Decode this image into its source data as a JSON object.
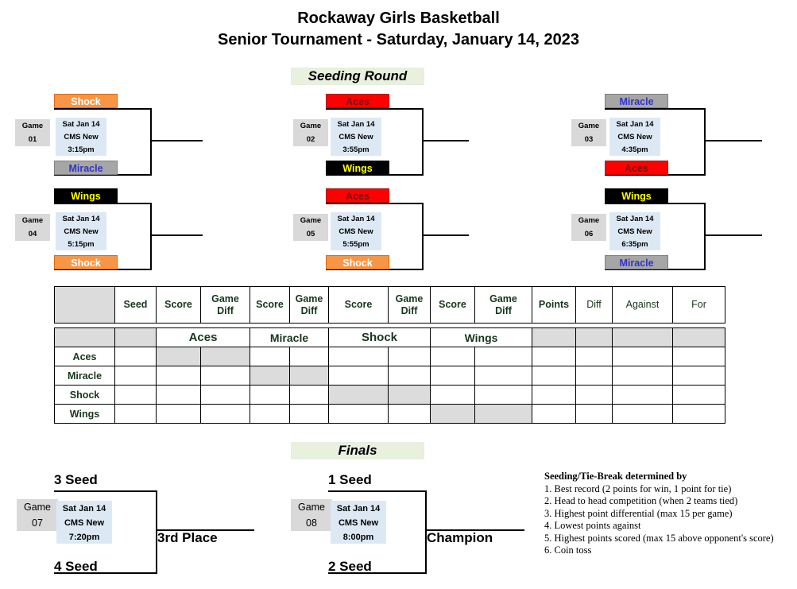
{
  "title": {
    "line1": "Rockaway Girls Basketball",
    "line2": "Senior Tournament - Saturday, January 14, 2023"
  },
  "sections": {
    "seeding_round": "Seeding Round",
    "finals": "Finals"
  },
  "seeding_games": [
    {
      "label_top": "Game",
      "label_num": "01",
      "date": "Sat Jan 14",
      "venue": "CMS New",
      "time": "3:15pm",
      "top_team": "Shock",
      "bottom_team": "Miracle"
    },
    {
      "label_top": "Game",
      "label_num": "02",
      "date": "Sat Jan 14",
      "venue": "CMS New",
      "time": "3:55pm",
      "top_team": "Aces",
      "bottom_team": "Wings"
    },
    {
      "label_top": "Game",
      "label_num": "03",
      "date": "Sat Jan 14",
      "venue": "CMS New",
      "time": "4:35pm",
      "top_team": "Miracle",
      "bottom_team": "Aces"
    },
    {
      "label_top": "Game",
      "label_num": "04",
      "date": "Sat Jan 14",
      "venue": "CMS New",
      "time": "5:15pm",
      "top_team": "Wings",
      "bottom_team": "Shock"
    },
    {
      "label_top": "Game",
      "label_num": "05",
      "date": "Sat Jan 14",
      "venue": "CMS New",
      "time": "5:55pm",
      "top_team": "Aces",
      "bottom_team": "Shock"
    },
    {
      "label_top": "Game",
      "label_num": "06",
      "date": "Sat Jan 14",
      "venue": "CMS New",
      "time": "6:35pm",
      "top_team": "Wings",
      "bottom_team": "Miracle"
    }
  ],
  "standings": {
    "header_row": [
      "",
      "Seed",
      "Score",
      "Game Diff",
      "Score",
      "Game Diff",
      "Score",
      "Game Diff",
      "Score",
      "Game Diff",
      "Points",
      "Diff",
      "Against",
      "For"
    ],
    "opponent_row": [
      "",
      "",
      "Aces",
      "Miracle",
      "Shock",
      "Wings",
      "",
      "",
      "",
      ""
    ],
    "rows": [
      {
        "team": "Aces"
      },
      {
        "team": "Miracle"
      },
      {
        "team": "Shock"
      },
      {
        "team": "Wings"
      }
    ]
  },
  "finals_games": [
    {
      "label_top": "Game",
      "label_num": "07",
      "date": "Sat Jan 14",
      "venue": "CMS New",
      "time": "7:20pm",
      "top_seed": "3 Seed",
      "bottom_seed": "4 Seed",
      "outcome": "3rd Place"
    },
    {
      "label_top": "Game",
      "label_num": "08",
      "date": "Sat Jan 14",
      "venue": "CMS New",
      "time": "8:00pm",
      "top_seed": "1 Seed",
      "bottom_seed": "2 Seed",
      "outcome": "Champion"
    }
  ],
  "rules": {
    "title": "Seeding/Tie-Break determined by",
    "items": [
      "1. Best record (2 points for win, 1 point for tie)",
      "2. Head to head competition (when 2 teams tied)",
      "3. Highest point differential (max 15 per game)",
      "4. Lowest points against",
      "5. Highest points scored (max 15 above opponent's score)",
      "6. Coin toss"
    ]
  },
  "colors": {
    "shock_bg": "#F79646",
    "miracle_bg": "#A6A6A6",
    "aces_bg": "#FF0000",
    "wings_bg": "#000000",
    "section_header_bg": "#e8f0de",
    "table_text": "#17371B",
    "info_bg": "#DCE9F5",
    "gamelabel_bg": "#D9D9D9"
  }
}
